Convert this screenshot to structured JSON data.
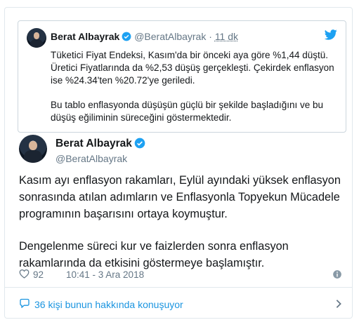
{
  "quoted_tweet": {
    "name": "Berat Albayrak",
    "handle": "@BeratAlbayrak",
    "separator": "·",
    "time_ago": "11 dk",
    "paragraph_1": "Tüketici Fiyat Endeksi, Kasım'da bir önceki aya göre %1,44 düştü. Üretici Fiyatlarında da %2,53 düşüş gerçekleşti. Çekirdek enflasyon ise %24.34'ten %20.72'ye geriledi.",
    "paragraph_2": "Bu tablo enflasyonda düşüşün güçlü bir şekilde başladığını ve bu düşüş eğiliminin süreceğini göstermektedir."
  },
  "main_tweet": {
    "name": "Berat Albayrak",
    "handle": "@BeratAlbayrak",
    "paragraph_1": "Kasım ayı enflasyon rakamları, Eylül ayındaki yüksek enflasyon sonrasında atılan adımların ve Enflasyonla Topyekun Mücadele programının başarısını ortaya koymuştur.",
    "paragraph_2": "Dengelenme süreci kur ve faizlerden sonra enflasyon rakamlarında da etkisini göstermeye başlamıştır.",
    "likes": "92",
    "timestamp": "10:41 - 3 Ara 2018"
  },
  "conversation": {
    "label": "36 kişi bunun hakkında konuşuyor"
  },
  "colors": {
    "accent": "#1b95e0",
    "text": "#14171a",
    "muted": "#657786",
    "border": "#e1e8ed"
  },
  "icons": [
    "verified-badge-icon",
    "twitter-bird-icon",
    "heart-icon",
    "info-icon",
    "speech-bubble-icon",
    "chevron-right-icon"
  ]
}
